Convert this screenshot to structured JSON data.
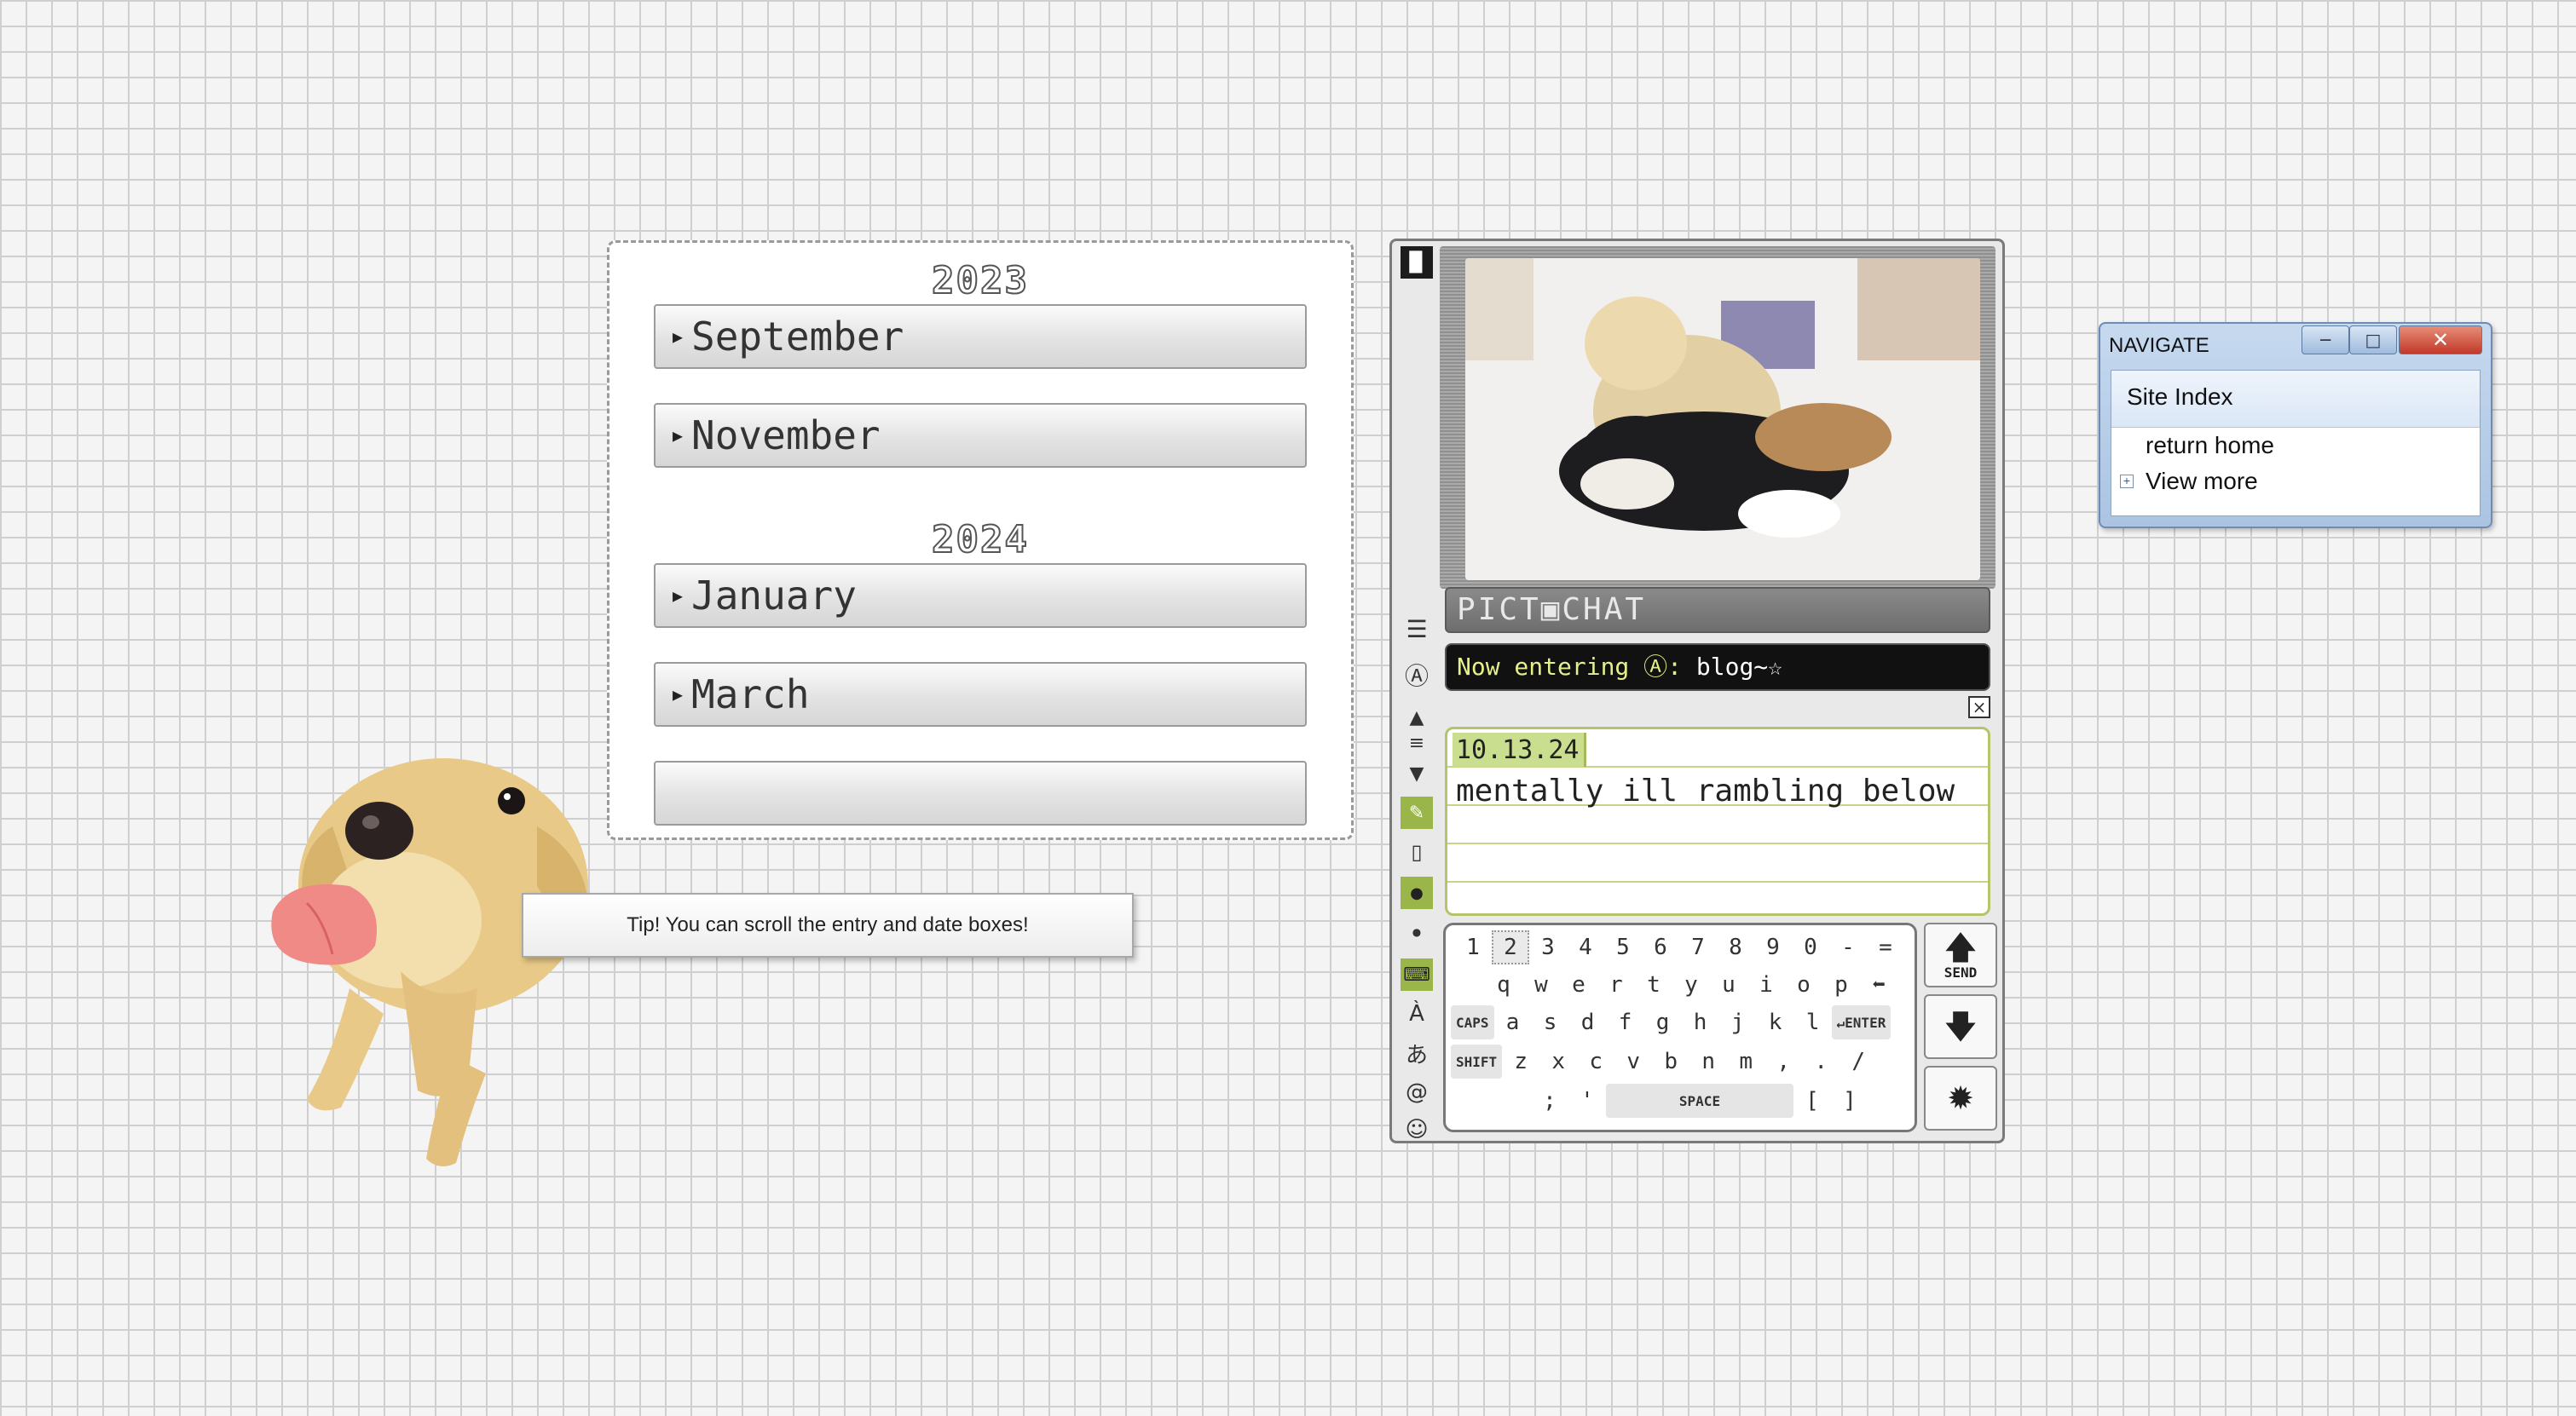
{
  "archive": {
    "groups": [
      {
        "year": "2023",
        "months": [
          "September",
          "November"
        ]
      },
      {
        "year": "2024",
        "months": [
          "January",
          "March"
        ]
      }
    ]
  },
  "tip": "Tip! You can scroll the entry and date boxes!",
  "pictochat": {
    "title": "PICT▣CHAT",
    "entering_label": "Now entering Ⓐ:",
    "entering_room": "blog~☆",
    "message": {
      "date": "10.13.24",
      "text": "mentally ill rambling below"
    },
    "keyboard": {
      "row1": [
        "1",
        "2",
        "3",
        "4",
        "5",
        "6",
        "7",
        "8",
        "9",
        "0",
        "-",
        "="
      ],
      "row2": [
        "q",
        "w",
        "e",
        "r",
        "t",
        "y",
        "u",
        "i",
        "o",
        "p",
        "⬅"
      ],
      "caps": "CAPS",
      "row3": [
        "a",
        "s",
        "d",
        "f",
        "g",
        "h",
        "j",
        "k",
        "l"
      ],
      "enter": "↵ENTER",
      "shift": "SHIFT",
      "row4": [
        "z",
        "x",
        "c",
        "v",
        "b",
        "n",
        "m",
        ",",
        ".",
        "/"
      ],
      "row5": [
        ";",
        "'"
      ],
      "space": "SPACE",
      "brackets": [
        "[",
        "]"
      ]
    },
    "send_label": "SEND"
  },
  "navigate": {
    "title": "NAVIGATE",
    "header": "Site Index",
    "links": [
      "return home",
      "View more"
    ]
  }
}
